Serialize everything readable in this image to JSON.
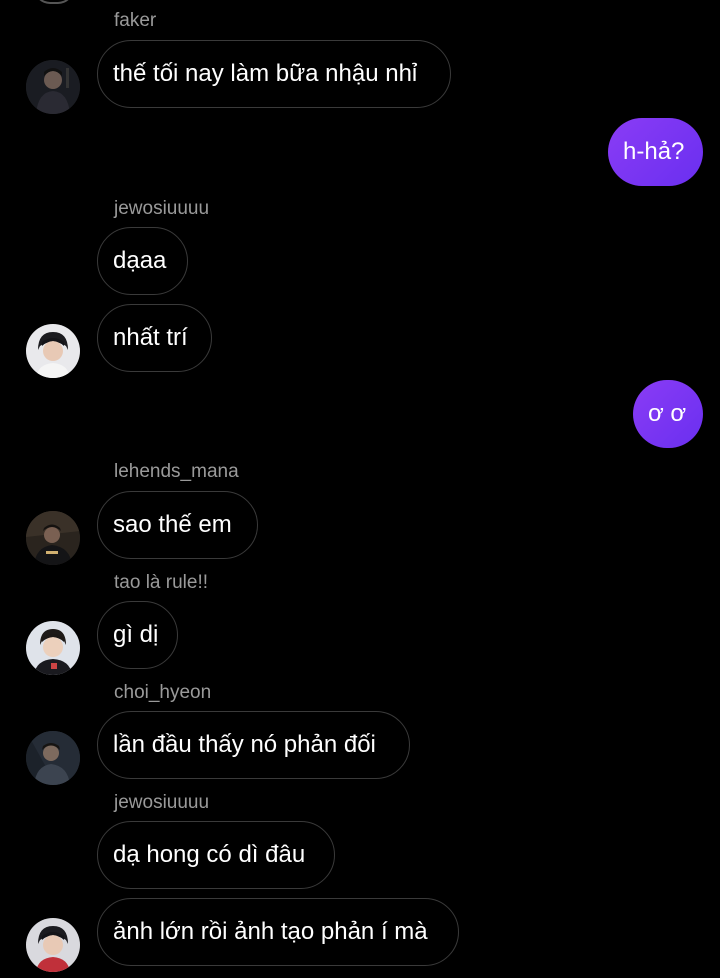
{
  "messages": [
    {
      "sender": "faker",
      "text": "thế tối nay làm bữa nhậu nhỉ"
    },
    {
      "self_text": "h-hả?"
    },
    {
      "sender": "jewosiuuuu",
      "text_1": "dạaa",
      "text_2": "nhất trí"
    },
    {
      "self_text": "ơ ơ"
    },
    {
      "sender": "lehends_mana",
      "text": "sao thế em"
    },
    {
      "sender": "tao là rule!!",
      "text": "gì dị"
    },
    {
      "sender": "choi_hyeon",
      "text": "lần đầu thấy nó phản đối"
    },
    {
      "sender": "jewosiuuuu",
      "text_1": "dạ hong có dì đâu",
      "text_2": "ảnh lớn rồi ảnh tạo phản í mà"
    }
  ],
  "colors": {
    "background": "#000000",
    "self_bubble": "#7b36f3",
    "bubble_border": "#3a3a3a",
    "username": "#9a9a9a"
  }
}
